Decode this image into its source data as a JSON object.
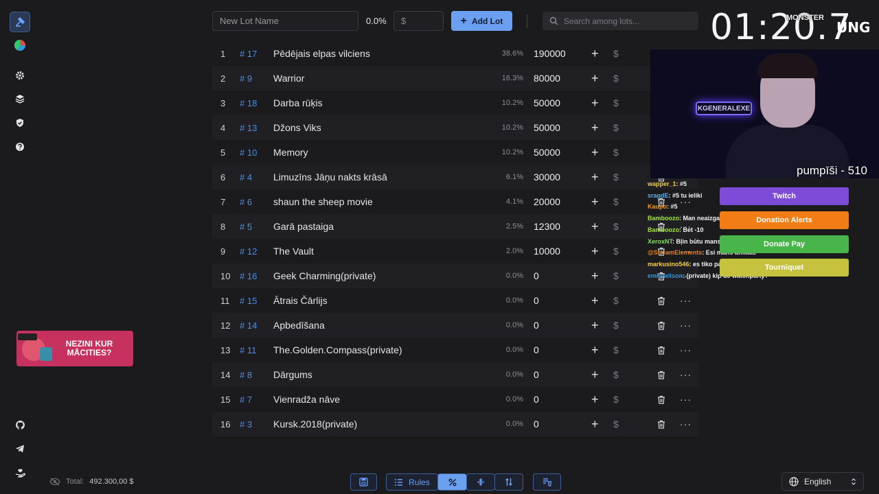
{
  "topbar": {
    "lot_name_placeholder": "New Lot Name",
    "percent": "0.0%",
    "amount_placeholder": "$",
    "add_lot_label": "Add Lot",
    "search_placeholder": "Search among lots..."
  },
  "lots": [
    {
      "index": "1",
      "id": "# 17",
      "name": "Pēdējais elpas vilciens",
      "percent": "38.6%",
      "amount": "190000"
    },
    {
      "index": "2",
      "id": "# 9",
      "name": "Warrior",
      "percent": "16.3%",
      "amount": "80000"
    },
    {
      "index": "3",
      "id": "# 18",
      "name": "Darba rūķis",
      "percent": "10.2%",
      "amount": "50000"
    },
    {
      "index": "4",
      "id": "# 13",
      "name": "Džons Viks",
      "percent": "10.2%",
      "amount": "50000"
    },
    {
      "index": "5",
      "id": "# 10",
      "name": "Memory",
      "percent": "10.2%",
      "amount": "50000"
    },
    {
      "index": "6",
      "id": "# 4",
      "name": "Limuzīns Jāņu nakts krāsā",
      "percent": "6.1%",
      "amount": "30000"
    },
    {
      "index": "7",
      "id": "# 6",
      "name": "shaun the sheep movie",
      "percent": "4.1%",
      "amount": "20000"
    },
    {
      "index": "8",
      "id": "# 5",
      "name": "Garā pastaiga",
      "percent": "2.5%",
      "amount": "12300"
    },
    {
      "index": "9",
      "id": "# 12",
      "name": "The Vault",
      "percent": "2.0%",
      "amount": "10000"
    },
    {
      "index": "10",
      "id": "# 16",
      "name": "Geek Charming(private)",
      "percent": "0.0%",
      "amount": "0"
    },
    {
      "index": "11",
      "id": "# 15",
      "name": "Ātrais Čārlijs",
      "percent": "0.0%",
      "amount": "0"
    },
    {
      "index": "12",
      "id": "# 14",
      "name": "Apbedīšana",
      "percent": "0.0%",
      "amount": "0"
    },
    {
      "index": "13",
      "id": "# 11",
      "name": "The.Golden.Compass(private)",
      "percent": "0.0%",
      "amount": "0"
    },
    {
      "index": "14",
      "id": "# 8",
      "name": "Dārgums",
      "percent": "0.0%",
      "amount": "0"
    },
    {
      "index": "15",
      "id": "# 7",
      "name": "Vienradža nāve",
      "percent": "0.0%",
      "amount": "0"
    },
    {
      "index": "16",
      "id": "# 3",
      "name": "Kursk.2018(private)",
      "percent": "0.0%",
      "amount": "0"
    }
  ],
  "row_actions": {
    "plus": "+",
    "dollar": "$",
    "more": "···"
  },
  "footer": {
    "total_label": "Total:",
    "total_value": "492.300,00 $",
    "rules_label": "Rules",
    "language": "English"
  },
  "promo": {
    "line1": "NEZINI KUR",
    "line2": "MĀCITIES?"
  },
  "overlay": {
    "timer": "01:20.7",
    "logo_monster": "MONSTER",
    "logo_ung": "UNG",
    "neon_sign": "KGENERALEXE",
    "cam_caption": "pumpīši - 510",
    "chat": [
      {
        "user": "wapper_1",
        "text": ": #5",
        "color": "#f4d03f"
      },
      {
        "user": "sragdE",
        "text": ": #5 tu ieliki",
        "color": "#5dade2"
      },
      {
        "user": "Kaupo",
        "text": ": #5",
        "color": "#f39c12"
      },
      {
        "user": "Bamboozo",
        "text": ": Man neaizgaja pirmareize",
        "color": "#a3e635"
      },
      {
        "user": "Bamboozo",
        "text": ": Bet -10",
        "color": "#a3e635"
      },
      {
        "user": "XeroxNT",
        "text": ": Bļin būtu mans profils iedotu, bet pats bračkas lietoju.",
        "color": "#84e35a"
      },
      {
        "user": "@StreamElements",
        "text": ": Esi mans affiliate ",
        "color": "#e67e22"
      },
      {
        "user": "markusino546",
        "text": ": es tiko pachekoju darba rukis ir pieejams",
        "color": "#f4d03f"
      },
      {
        "user": "emilswilson",
        "text": ": (private) kip dc watchparty?",
        "color": "#3498db"
      }
    ],
    "donations": [
      {
        "label": "Twitch",
        "color": "#7d4bd8"
      },
      {
        "label": "Donation Alerts",
        "color": "#f17d14"
      },
      {
        "label": "Donate Pay",
        "color": "#47b54a"
      },
      {
        "label": "Tourniquet",
        "color": "#c6c23e"
      }
    ]
  }
}
